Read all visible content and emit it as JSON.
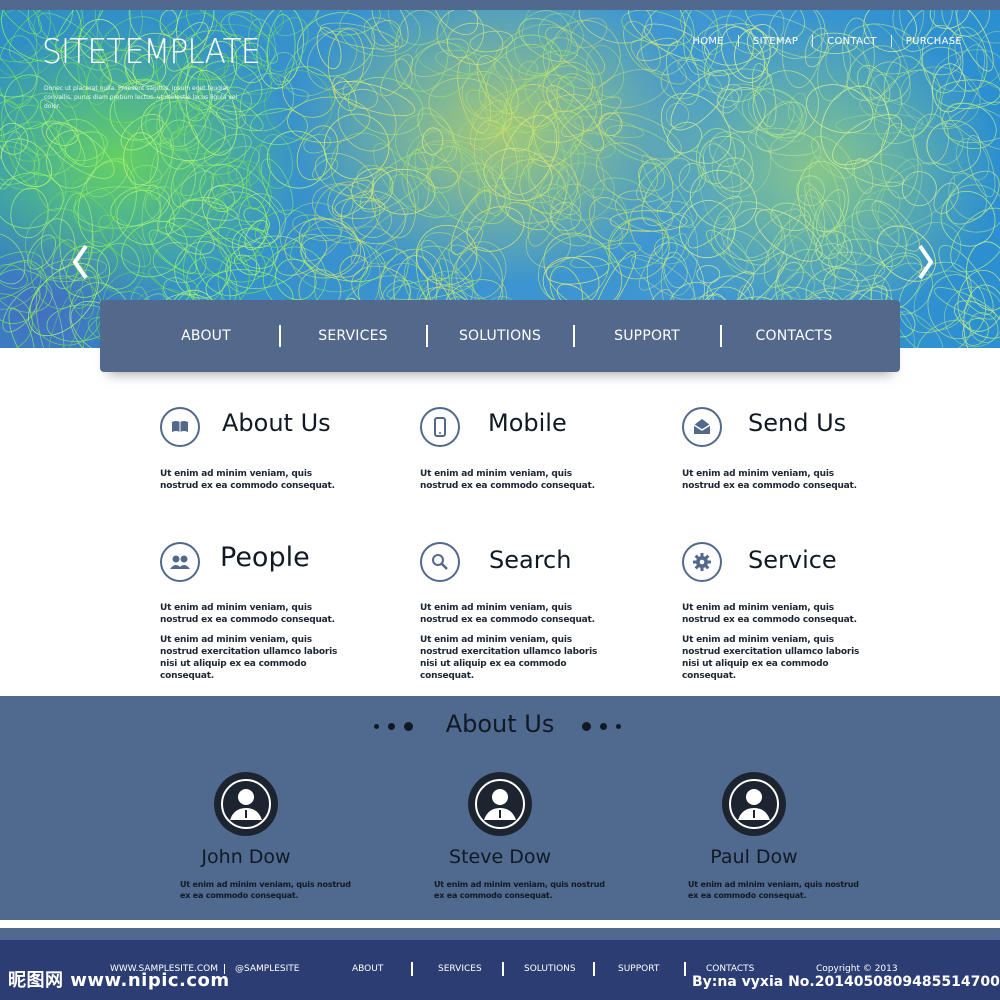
{
  "hero": {
    "logo": "SITETEMPLATE",
    "tagline": "Donec ut placerat nulla. Praesent sagittis, ipsum eget feugiat convallis, purus diam pretium lectus, ut molestie lacus ligula vel dolor.",
    "top_nav": [
      "HOME",
      "SITEMAP",
      "CONTACT",
      "PURCHASE"
    ],
    "prev_icon": "chevron-left-icon",
    "next_icon": "chevron-right-icon"
  },
  "main_nav": [
    "ABOUT",
    "SERVICES",
    "SOLUTIONS",
    "SUPPORT",
    "CONTACTS"
  ],
  "features": [
    {
      "icon": "book-icon",
      "title": "About Us",
      "text1": "Ut enim ad minim veniam, quis nostrud ex ea commodo consequat.",
      "text2": ""
    },
    {
      "icon": "mobile-icon",
      "title": "Mobile",
      "text1": "Ut enim ad minim veniam, quis nostrud ex ea commodo consequat.",
      "text2": ""
    },
    {
      "icon": "mail-icon",
      "title": "Send Us",
      "text1": "Ut enim ad minim veniam, quis nostrud ex ea commodo consequat.",
      "text2": ""
    },
    {
      "icon": "people-icon",
      "title": "People",
      "text1": "Ut enim ad minim veniam, quis nostrud ex ea commodo consequat.",
      "text2": "Ut enim ad minim veniam, quis nostrud exercitation ullamco laboris nisi ut aliquip ex ea commodo consequat."
    },
    {
      "icon": "search-icon",
      "title": "Search",
      "text1": "Ut enim ad minim veniam, quis nostrud ex ea commodo consequat.",
      "text2": "Ut enim ad minim veniam, quis nostrud exercitation ullamco laboris nisi ut aliquip ex ea commodo consequat."
    },
    {
      "icon": "gear-icon",
      "title": "Service",
      "text1": "Ut enim ad minim veniam, quis nostrud ex ea commodo consequat.",
      "text2": "Ut enim ad minim veniam, quis nostrud exercitation ullamco laboris nisi ut aliquip ex ea commodo consequat."
    }
  ],
  "team": {
    "title": "About Us",
    "members": [
      {
        "name": "John Dow",
        "text": "Ut enim ad minim veniam, quis nostrud ex ea commodo consequat."
      },
      {
        "name": "Steve Dow",
        "text": "Ut enim ad minim veniam, quis nostrud ex ea commodo consequat."
      },
      {
        "name": "Paul Dow",
        "text": "Ut enim ad minim veniam, quis nostrud ex ea commodo consequat."
      }
    ]
  },
  "footer": {
    "website": "WWW.SAMPLESITE.COM",
    "twitter": "@SAMPLESITE",
    "nav": [
      "ABOUT",
      "SERVICES",
      "SOLUTIONS",
      "SUPPORT",
      "CONTACTS"
    ],
    "copyright": "Copyright © 2013"
  },
  "watermark": {
    "left": "昵图网 www.nipic.com",
    "right": "By:na vyxia  No.20140508094855147000"
  },
  "colors": {
    "nav_bar": "#52698b",
    "team_bg": "#50698f",
    "footer_bg": "#2c3d74"
  }
}
